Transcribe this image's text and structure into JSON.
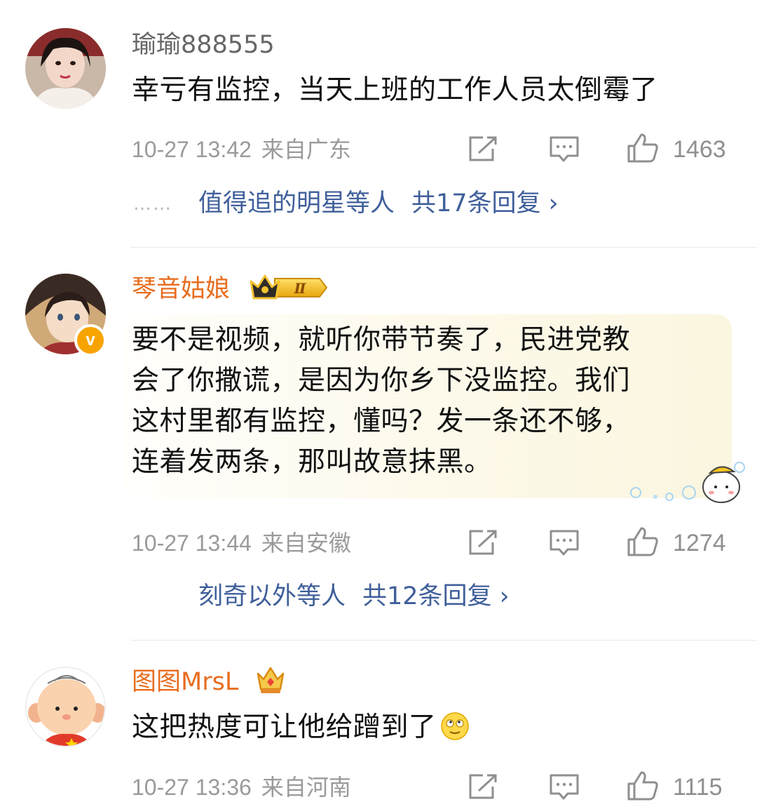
{
  "comments": [
    {
      "username": "瑜瑜888555",
      "text": "幸亏有监控，当天上班的工作人员太倒霉了",
      "time": "10-27 13:42",
      "location": "来自广东",
      "likes": "1463",
      "reply_names": "值得追的明星等人",
      "reply_count": "共17条回复 ›",
      "reply_prefix": "……"
    },
    {
      "username": "琴音姑娘",
      "badge": "Ⅱ",
      "verified": "v",
      "text_lines": [
        "要不是视频，就听你带节奏了，民进党教",
        "会了你撒谎，是因为你乡下没监控。我们",
        "这村里都有监控，懂吗？发一条还不够，",
        "连着发两条，那叫故意抹黑。"
      ],
      "time": "10-27 13:44",
      "location": "来自安徽",
      "likes": "1274",
      "reply_names": "刻奇以外等人",
      "reply_count": "共12条回复 ›"
    },
    {
      "username": "图图MrsL",
      "text": "这把热度可让他给蹭到了",
      "time": "10-27 13:36",
      "location": "来自河南",
      "likes": "1115"
    }
  ],
  "colors": {
    "link": "#3f5f9a",
    "vip_name": "#e86d1f",
    "meta": "#9a9a9a"
  },
  "icons": [
    "share-icon",
    "comment-icon",
    "like-icon",
    "crown-icon",
    "verified-icon",
    "emoji-icon"
  ]
}
